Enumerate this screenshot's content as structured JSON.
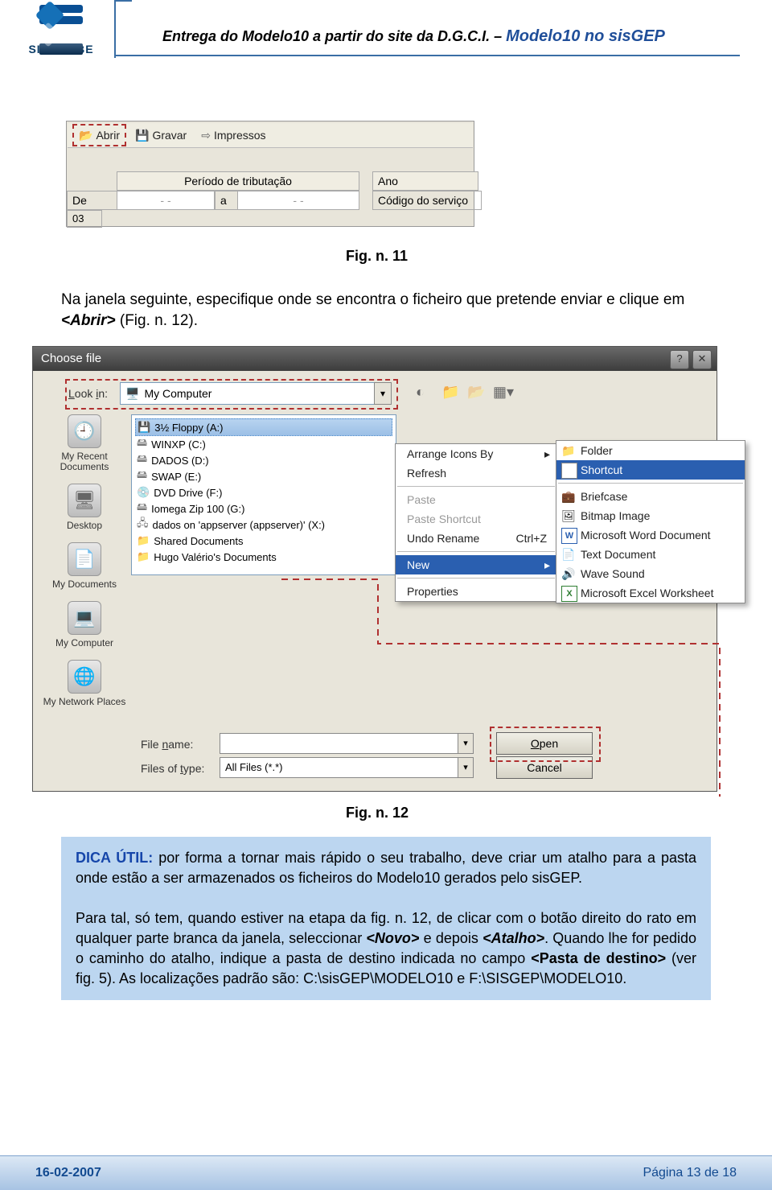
{
  "header": {
    "logo_text": "SISGARBE",
    "title_prefix": "Entrega do Modelo10 a partir do site da D.G.C.I. – ",
    "title_suffix": "Modelo10 no sisGEP"
  },
  "toolbar": {
    "open": "Abrir",
    "save": "Gravar",
    "print": "Impressos",
    "periodo": "Período de tributação",
    "ano": "Ano",
    "de": "De",
    "a": "a",
    "codigo": "Código do serviço",
    "left_num": "03",
    "dash": "-    -"
  },
  "fig11": "Fig. n. 11",
  "fig12": "Fig. n. 12",
  "para1_a": "Na janela seguinte, especifique onde se encontra o ficheiro que pretende enviar e clique em ",
  "para1_b": "<Abrir>",
  "para1_c": " (Fig. n. 12).",
  "dialog": {
    "title": "Choose file",
    "lookin_lbl": "Look in:",
    "lookin_val": "My Computer",
    "sidebar": [
      "My Recent Documents",
      "Desktop",
      "My Documents",
      "My Computer",
      "My Network Places"
    ],
    "drives": [
      "3½ Floppy (A:)",
      "WINXP (C:)",
      "DADOS (D:)",
      "SWAP (E:)",
      "DVD Drive (F:)",
      "Iomega Zip 100 (G:)",
      "dados on 'appserver (appserver)' (X:)",
      "Shared Documents",
      "Hugo Valério's Documents"
    ],
    "ctx": {
      "arrange": "Arrange Icons By",
      "refresh": "Refresh",
      "paste": "Paste",
      "paste_sc": "Paste Shortcut",
      "undo": "Undo Rename",
      "undo_k": "Ctrl+Z",
      "new": "New",
      "props": "Properties"
    },
    "submenu": [
      "Folder",
      "Shortcut",
      "Briefcase",
      "Bitmap Image",
      "Microsoft Word Document",
      "Text Document",
      "Wave Sound",
      "Microsoft Excel Worksheet"
    ],
    "fn_lbl": "File name:",
    "ft_lbl": "Files of type:",
    "ft_val": "All Files (*.*)",
    "open": "Open",
    "cancel": "Cancel"
  },
  "tip": {
    "lead": "DICA ÚTIL:",
    "p1": " por forma a tornar mais rápido o seu trabalho, deve criar um atalho para a pasta onde estão a ser armazenados os ficheiros do Modelo10 gerados pelo sisGEP.",
    "p2a": "Para tal, só tem, quando estiver na etapa da fig. n. 12, de clicar com o botão direito do rato em qualquer parte branca da janela, seleccionar ",
    "p2b": "<Novo>",
    "p2c": " e depois ",
    "p2d": "<Atalho>",
    "p2e": ". Quando lhe for pedido o caminho do atalho, indique a pasta de destino indicada no campo ",
    "p2f": "<Pasta de destino>",
    "p2g": " (ver fig. 5). As localizações padrão são: C:\\sisGEP\\MODELO10 e F:\\SISGEP\\MODELO10."
  },
  "footer": {
    "date": "16-02-2007",
    "page": "Página 13 de 18"
  }
}
